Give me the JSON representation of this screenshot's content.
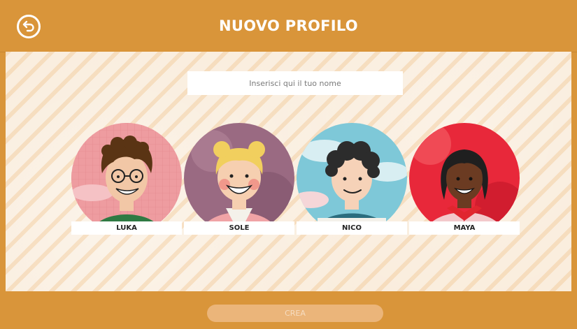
{
  "header": {
    "title": "NUOVO PROFILO",
    "back_icon": "back-arrow-icon"
  },
  "name_field": {
    "placeholder": "Inserisci qui il tuo nome",
    "value": ""
  },
  "avatars": [
    {
      "name": "LUKA"
    },
    {
      "name": "SOLE"
    },
    {
      "name": "NICO"
    },
    {
      "name": "MAYA"
    }
  ],
  "footer": {
    "create_label": "CREA"
  },
  "colors": {
    "header_bg": "#d9953a",
    "main_bg": "#f9ebd9",
    "create_disabled_bg": "#ebb57a",
    "create_disabled_text": "#f6dcc0"
  }
}
